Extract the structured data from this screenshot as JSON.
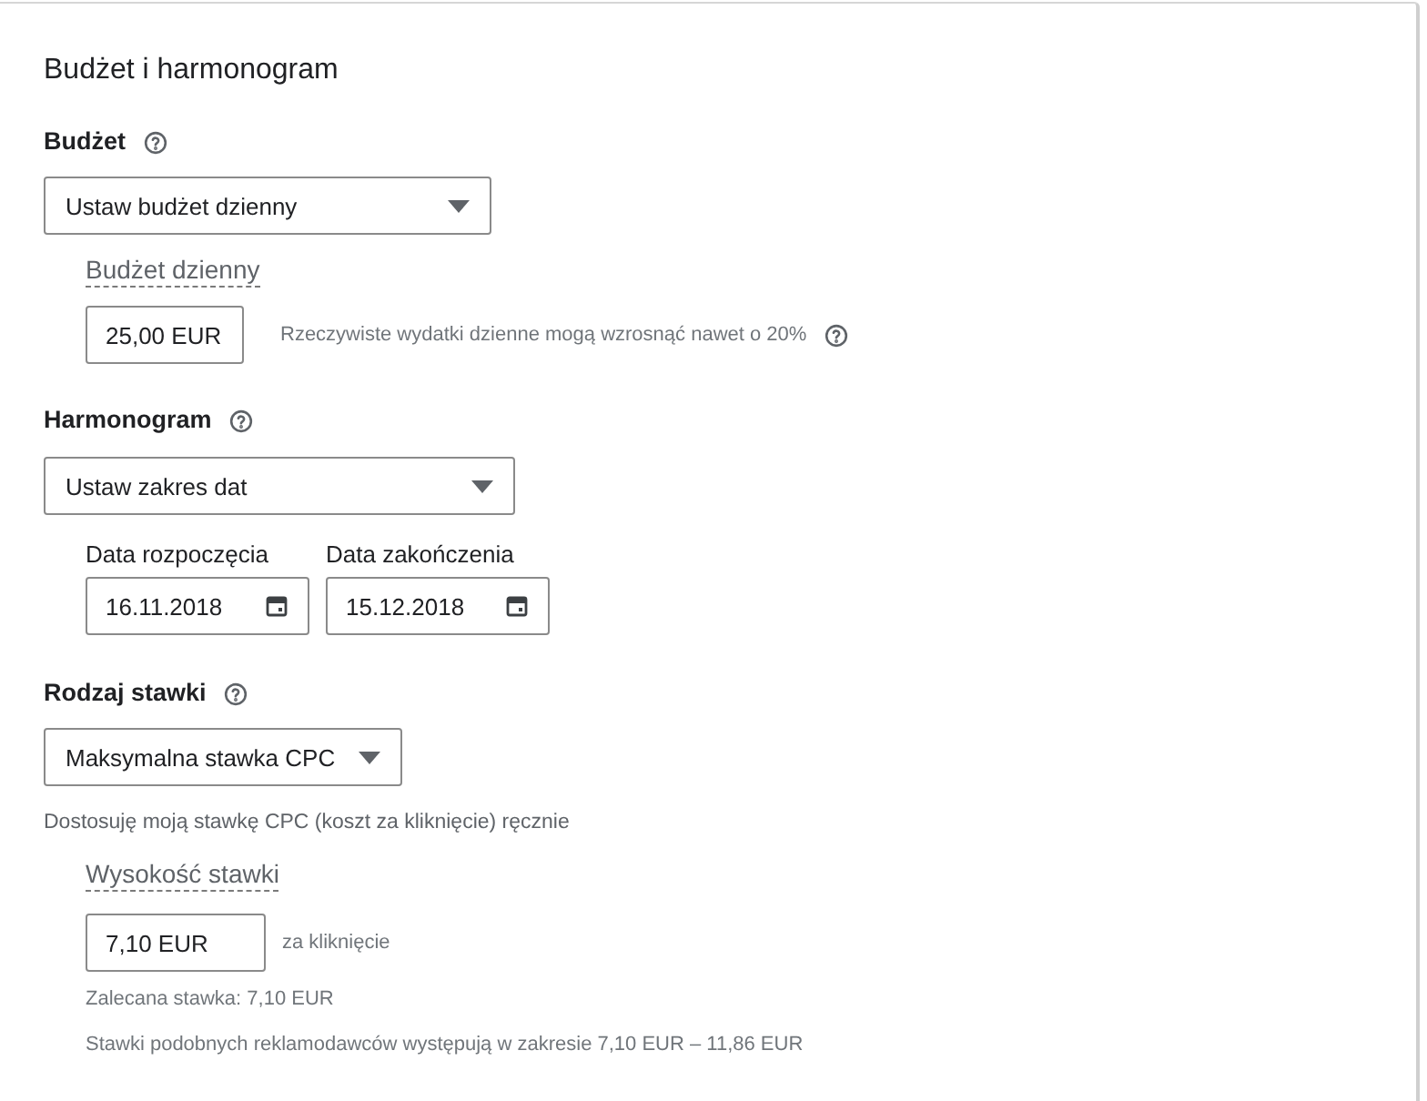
{
  "title": "Budżet i harmonogram",
  "budget": {
    "label": "Budżet",
    "dropdown": {
      "value": "Ustaw budżet dzienny"
    },
    "field": {
      "label": "Budżet dzienny",
      "value": "25,00 EUR",
      "hint": "Rzeczywiste wydatki dzienne mogą wzrosnąć nawet o 20%"
    }
  },
  "schedule": {
    "label": "Harmonogram",
    "dropdown": {
      "value": "Ustaw zakres dat"
    },
    "dates": [
      {
        "label": "Data rozpoczęcia",
        "value": "16.11.2018"
      },
      {
        "label": "Data zakończenia",
        "value": "15.12.2018"
      }
    ]
  },
  "bidding": {
    "label": "Rodzaj stawki",
    "dropdown": {
      "value": "Maksymalna stawka CPC"
    },
    "note": "Dostosuję moją stawkę CPC (koszt za kliknięcie) ręcznie",
    "field": {
      "label": "Wysokość stawki",
      "value": "7,10 EUR",
      "suffix": "za kliknięcie"
    },
    "recommended": "Zalecana stawka: 7,10 EUR",
    "range": "Stawki podobnych reklamodawców występują w zakresie 7,10 EUR – 11,86 EUR"
  }
}
